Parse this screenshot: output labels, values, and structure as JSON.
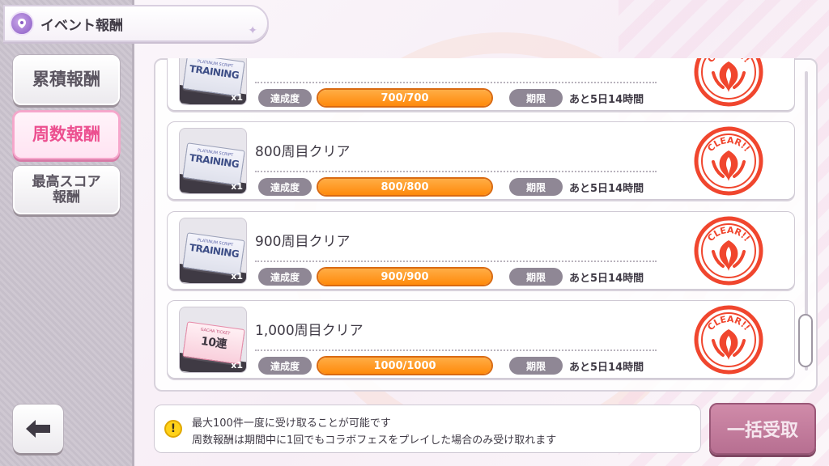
{
  "header": {
    "title": "イベント報酬"
  },
  "sidebar": {
    "tabs": [
      {
        "label": "累積報酬",
        "active": false
      },
      {
        "label": "周数報酬",
        "active": true
      },
      {
        "label": "最高スコア\n報酬",
        "label_line1": "最高スコア",
        "label_line2": "報酬",
        "active": false
      }
    ],
    "back_icon": "back-arrow-icon"
  },
  "labels": {
    "progress": "達成度",
    "limit": "期限"
  },
  "rewards": [
    {
      "title": "",
      "ticket_type": "training",
      "ticket_sub": "PLATINUM SCRIPT",
      "ticket_main": "TRAINING",
      "quantity": "x1",
      "progress_text": "700/700",
      "progress": 1.0,
      "limit_text": "あと5日14時間",
      "stamp": "CLEAR!!"
    },
    {
      "title": "800周目クリア",
      "ticket_type": "training",
      "ticket_sub": "PLATINUM SCRIPT",
      "ticket_main": "TRAINING",
      "quantity": "x1",
      "progress_text": "800/800",
      "progress": 1.0,
      "limit_text": "あと5日14時間",
      "stamp": "CLEAR!!"
    },
    {
      "title": "900周目クリア",
      "ticket_type": "training",
      "ticket_sub": "PLATINUM SCRIPT",
      "ticket_main": "TRAINING",
      "quantity": "x1",
      "progress_text": "900/900",
      "progress": 1.0,
      "limit_text": "あと5日14時間",
      "stamp": "CLEAR!!"
    },
    {
      "title": "1,000周目クリア",
      "ticket_type": "gacha",
      "ticket_sub": "GACHA TICKET",
      "ticket_main": "10連",
      "quantity": "x1",
      "progress_text": "1000/1000",
      "progress": 1.0,
      "limit_text": "あと5日14時間",
      "stamp": "CLEAR!!"
    }
  ],
  "info": {
    "icon": "info-exclamation-icon",
    "line1": "最大100件一度に受け取ることが可能です",
    "line2": "周数報酬は期間中に1回でもコラボフェスをプレイした場合のみ受け取れます"
  },
  "claim_all_button": {
    "label": "一括受取",
    "enabled": false
  },
  "colors": {
    "accent_pink": "#ec4f8f",
    "progress_orange": "#ff8a0b",
    "stamp_red": "#f0462e",
    "disabled_button": "#c07c9b"
  }
}
